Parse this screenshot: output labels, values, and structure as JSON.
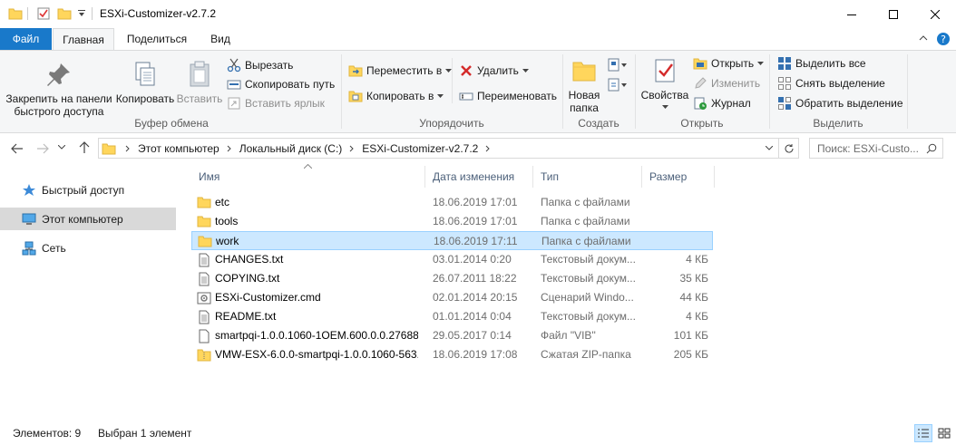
{
  "window": {
    "title": "ESXi-Customizer-v2.7.2"
  },
  "tabs": [
    {
      "label": "Файл"
    },
    {
      "label": "Главная"
    },
    {
      "label": "Поделиться"
    },
    {
      "label": "Вид"
    }
  ],
  "ribbon": {
    "clipboard": {
      "pin_label": "Закрепить на панели быстрого доступа",
      "copy_label": "Копировать",
      "paste_label": "Вставить",
      "cut_label": "Вырезать",
      "copy_path_label": "Скопировать путь",
      "paste_shortcut_label": "Вставить ярлык",
      "group_label": "Буфер обмена"
    },
    "organize": {
      "move_to_label": "Переместить в",
      "copy_to_label": "Копировать в",
      "delete_label": "Удалить",
      "rename_label": "Переименовать",
      "group_label": "Упорядочить"
    },
    "new": {
      "new_folder_label": "Новая папка",
      "group_label": "Создать"
    },
    "open": {
      "properties_label": "Свойства",
      "open_label": "Открыть",
      "edit_label": "Изменить",
      "history_label": "Журнал",
      "group_label": "Открыть"
    },
    "select": {
      "select_all_label": "Выделить все",
      "select_none_label": "Снять выделение",
      "invert_label": "Обратить выделение",
      "group_label": "Выделить"
    }
  },
  "address": {
    "crumbs": [
      "Этот компьютер",
      "Локальный диск (C:)",
      "ESXi-Customizer-v2.7.2"
    ],
    "search_placeholder": "Поиск: ESXi-Custo..."
  },
  "nav": {
    "items": [
      {
        "label": "Быстрый доступ"
      },
      {
        "label": "Этот компьютер"
      },
      {
        "label": "Сеть"
      }
    ]
  },
  "columns": {
    "name": "Имя",
    "date": "Дата изменения",
    "type": "Тип",
    "size": "Размер"
  },
  "files": [
    {
      "name": "etc",
      "date": "18.06.2019 17:01",
      "type": "Папка с файлами",
      "size": "",
      "icon": "folder"
    },
    {
      "name": "tools",
      "date": "18.06.2019 17:01",
      "type": "Папка с файлами",
      "size": "",
      "icon": "folder"
    },
    {
      "name": "work",
      "date": "18.06.2019 17:11",
      "type": "Папка с файлами",
      "size": "",
      "icon": "folder"
    },
    {
      "name": "CHANGES.txt",
      "date": "03.01.2014 0:20",
      "type": "Текстовый докум...",
      "size": "4 КБ",
      "icon": "text"
    },
    {
      "name": "COPYING.txt",
      "date": "26.07.2011 18:22",
      "type": "Текстовый докум...",
      "size": "35 КБ",
      "icon": "text"
    },
    {
      "name": "ESXi-Customizer.cmd",
      "date": "02.01.2014 20:15",
      "type": "Сценарий Windo...",
      "size": "44 КБ",
      "icon": "script"
    },
    {
      "name": "README.txt",
      "date": "01.01.2014 0:04",
      "type": "Текстовый докум...",
      "size": "4 КБ",
      "icon": "text"
    },
    {
      "name": "smartpqi-1.0.0.1060-1OEM.600.0.0.27688...",
      "date": "29.05.2017 0:14",
      "type": "Файл \"VIB\"",
      "size": "101 КБ",
      "icon": "file"
    },
    {
      "name": "VMW-ESX-6.0.0-smartpqi-1.0.0.1060-563...",
      "date": "18.06.2019 17:08",
      "type": "Сжатая ZIP-папка",
      "size": "205 КБ",
      "icon": "zip"
    }
  ],
  "status": {
    "count": "Элементов: 9",
    "selected": "Выбран 1 элемент"
  },
  "colors": {
    "accent": "#1979ca",
    "selection": "#cce8ff",
    "folder": "#ffd65c"
  }
}
